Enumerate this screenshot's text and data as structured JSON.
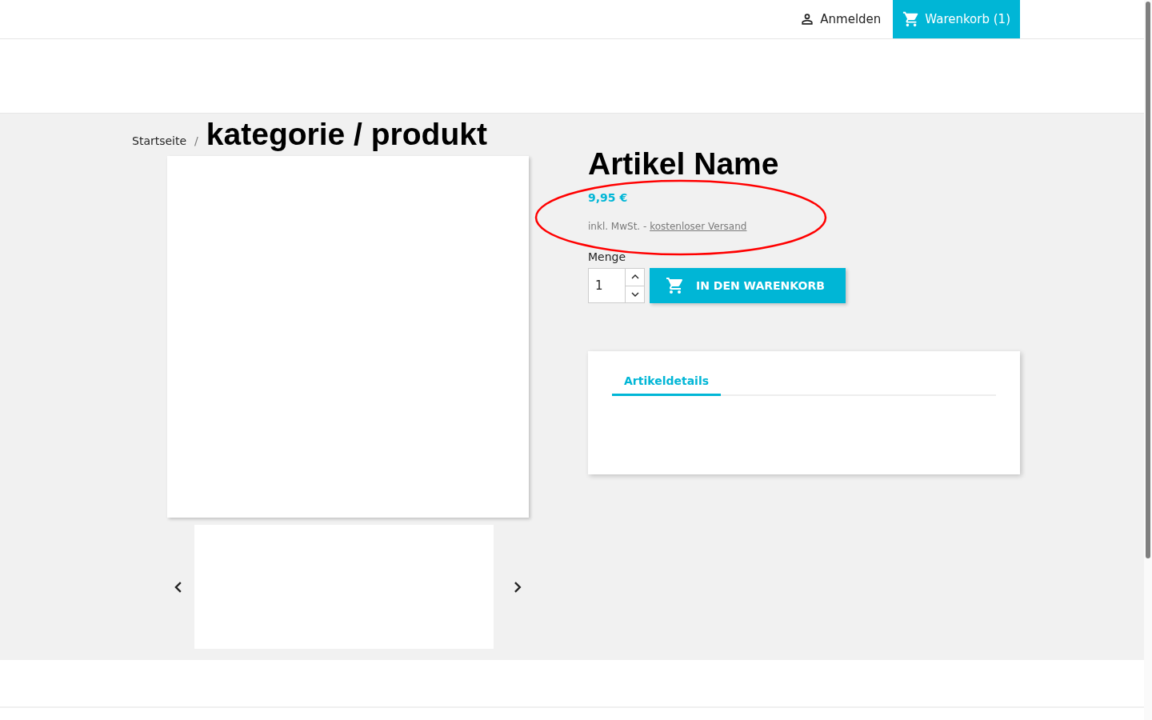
{
  "header": {
    "login": {
      "label": "Anmelden"
    },
    "cart": {
      "label": "Warenkorb (1)"
    }
  },
  "breadcrumb": {
    "separator": "/",
    "items": [
      {
        "label": "Startseite",
        "kind": "link"
      },
      {
        "label": "kategorie / produkt",
        "kind": "current"
      }
    ]
  },
  "product": {
    "name": "Artikel Name",
    "price": "9,95 €",
    "tax_note": "inkl. MwSt.",
    "tax_separator": "-",
    "shipping_link": "kostenloser Versand",
    "quantity": {
      "label": "Menge",
      "value": "1"
    },
    "add_button": "IN DEN WARENKORB",
    "tabs": [
      {
        "label": "Artikeldetails",
        "selected": true
      }
    ]
  }
}
